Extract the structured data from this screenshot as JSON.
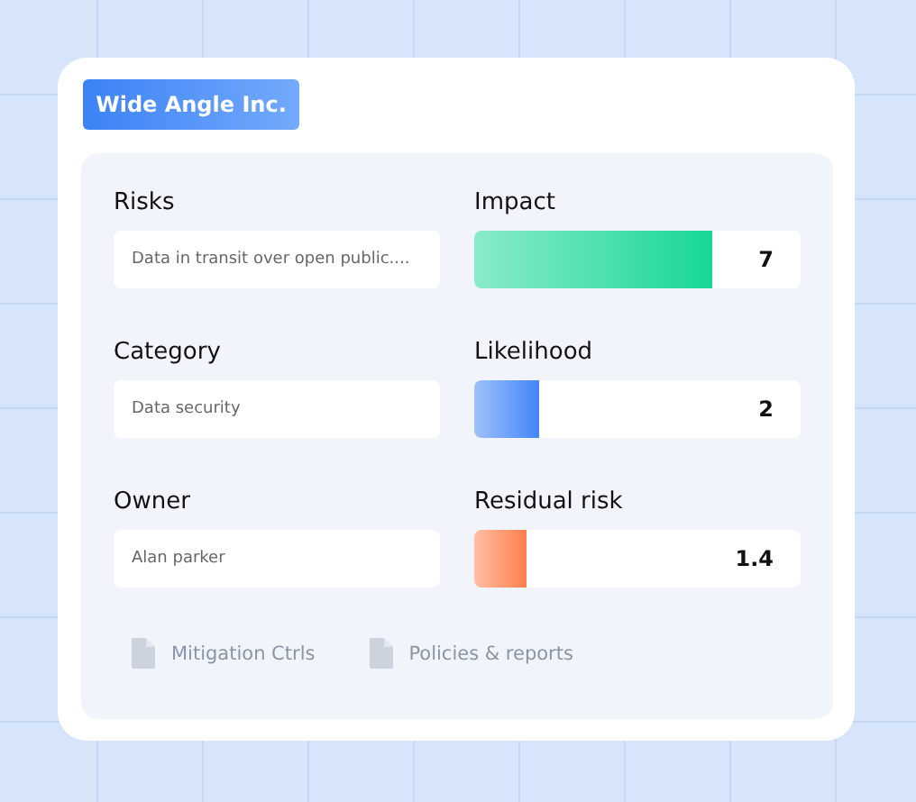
{
  "badge": "Wide Angle Inc.",
  "fields": [
    {
      "label": "Risks",
      "value": "Data in transit over open public...."
    },
    {
      "label": "Category",
      "value": "Data security"
    },
    {
      "label": "Owner",
      "value": "Alan parker"
    }
  ],
  "meters": [
    {
      "label": "Impact",
      "level": 0.73,
      "reading": "7",
      "color": "#17d796"
    },
    {
      "label": "Likelihood",
      "level": 0.2,
      "reading": "2",
      "color": "#4285f8"
    },
    {
      "label": "Residual risk",
      "level": 0.16,
      "reading": "1.4",
      "color": "#ff7f4d"
    }
  ],
  "links": [
    "Mitigation Ctrls",
    "Policies & reports"
  ]
}
